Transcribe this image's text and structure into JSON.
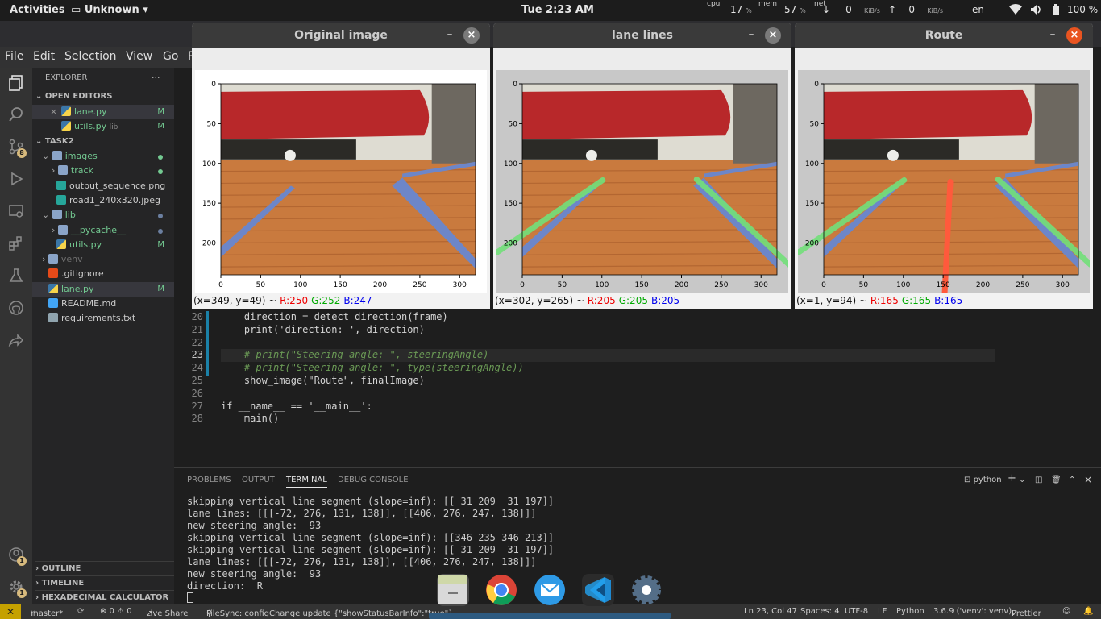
{
  "topbar": {
    "activities": "Activities",
    "app_name": "Unknown",
    "clock": "Tue  2:23 AM",
    "cpu_label": "cpu",
    "cpu_value": "17",
    "cpu_unit": "%",
    "mem_label": "mem",
    "mem_value": "57",
    "mem_unit": "%",
    "net_label": "net",
    "net_down": "0",
    "net_down_unit": "KiB/s",
    "net_up": "0",
    "net_up_unit": "KiB/s",
    "lang": "en",
    "battery": "100 %"
  },
  "menubar": [
    "File",
    "Edit",
    "Selection",
    "View",
    "Go",
    "R"
  ],
  "explorer": {
    "title": "EXPLORER",
    "open_editors": "OPEN EDITORS",
    "open_files": [
      {
        "name": "lane.py",
        "marker": "M",
        "close": "×"
      },
      {
        "name": "utils.py",
        "hint": "lib",
        "marker": "M"
      }
    ],
    "project": "TASK2",
    "tree": [
      {
        "name": "images",
        "type": "folder-open",
        "color": "#73c991"
      },
      {
        "name": "track",
        "type": "folder",
        "color": "#73c991"
      },
      {
        "name": "output_sequence.png",
        "type": "image",
        "color": "#ccc"
      },
      {
        "name": "road1_240x320.jpeg",
        "type": "image",
        "color": "#ccc"
      },
      {
        "name": "lib",
        "type": "folder-open",
        "color": "#73c991"
      },
      {
        "name": "__pycache__",
        "type": "folder",
        "color": "#73c991"
      },
      {
        "name": "utils.py",
        "type": "python",
        "color": "#73c991",
        "marker": "M"
      },
      {
        "name": "venv",
        "type": "folder",
        "color": "#6e6e6e"
      },
      {
        "name": ".gitignore",
        "type": "git",
        "color": "#ccc"
      },
      {
        "name": "lane.py",
        "type": "python",
        "color": "#73c991",
        "marker": "M"
      },
      {
        "name": "README.md",
        "type": "info",
        "color": "#ccc"
      },
      {
        "name": "requirements.txt",
        "type": "text",
        "color": "#ccc"
      }
    ],
    "outline": "OUTLINE",
    "timeline": "TIMELINE",
    "hex": "HEXADECIMAL CALCULATOR"
  },
  "activity_badges": {
    "scm": "8",
    "account": "1",
    "settings": "1"
  },
  "code": {
    "lines": [
      {
        "n": "20",
        "text": "    direction = detect_direction(frame)"
      },
      {
        "n": "21",
        "text": "    print('direction: ', direction)"
      },
      {
        "n": "22",
        "text": ""
      },
      {
        "n": "23",
        "text": "    # print(\"Steering angle: \", steeringAngle)"
      },
      {
        "n": "24",
        "text": "    # print(\"Steering angle: \", type(steeringAngle))"
      },
      {
        "n": "25",
        "text": "    show_image(\"Route\", finalImage)"
      },
      {
        "n": "26",
        "text": ""
      },
      {
        "n": "27",
        "text": "if __name__ == '__main__':"
      },
      {
        "n": "28",
        "text": "    main()"
      }
    ]
  },
  "panel": {
    "tabs": [
      "PROBLEMS",
      "OUTPUT",
      "TERMINAL",
      "DEBUG CONSOLE"
    ],
    "active_tab": "TERMINAL",
    "shell": "python",
    "terminal_lines": [
      "skipping vertical line segment (slope=inf): [[ 31 209  31 197]]",
      "lane lines: [[[-72, 276, 131, 138]], [[406, 276, 247, 138]]]",
      "new steering angle:  93",
      "skipping vertical line segment (slope=inf): [[346 235 346 213]]",
      "skipping vertical line segment (slope=inf): [[ 31 209  31 197]]",
      "lane lines: [[[-72, 276, 131, 138]], [[406, 276, 247, 138]]]",
      "new steering angle:  93",
      "direction:  R"
    ]
  },
  "statusbar": {
    "branch": "master*",
    "problems": "⊗ 0 ⚠ 0",
    "liveshare": "Live Share",
    "filesync": "FileSync: configChange update {\"showStatusBarInfo\":\"true\"}",
    "position": "Ln 23, Col 47",
    "spaces": "Spaces: 4",
    "encoding": "UTF-8",
    "eol": "LF",
    "language": "Python",
    "interpreter": "3.6.9 ('venv': venv)",
    "prettier": "Prettier"
  },
  "windows": [
    {
      "title": "Original image",
      "status_xy": "(x=349, y=49) ~ ",
      "r": "R:250",
      "g": "G:252",
      "b": "B:247",
      "close_color": "#7a7a7a",
      "lines": "none"
    },
    {
      "title": "lane lines",
      "status_xy": "(x=302, y=265) ~ ",
      "r": "R:205",
      "g": "G:205",
      "b": "B:205",
      "close_color": "#7a7a7a",
      "lines": "green"
    },
    {
      "title": "Route",
      "status_xy": "(x=1, y=94) ~ ",
      "r": "R:165",
      "g": "G:165",
      "b": "B:165",
      "close_color": "#e95420",
      "lines": "route"
    }
  ],
  "plot_axes": {
    "x_ticks": [
      "0",
      "50",
      "100",
      "150",
      "200",
      "250",
      "300"
    ],
    "y_ticks": [
      "0",
      "50",
      "100",
      "150",
      "200"
    ]
  },
  "dock": [
    "files",
    "chrome",
    "mail",
    "vscode",
    "settings"
  ]
}
